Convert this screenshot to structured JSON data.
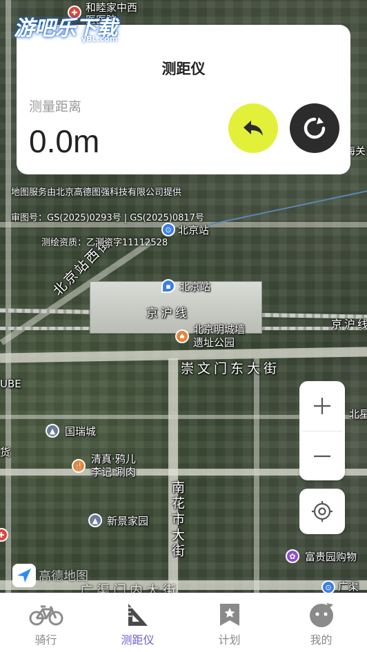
{
  "watermark": {
    "text": "游吧乐下载",
    "sub": "yBL.com"
  },
  "card": {
    "title": "测距仪",
    "distance_label": "测量距离",
    "distance_value": "0.0m",
    "undo_color": "#e3f03a",
    "reset_color": "#2c2c2c"
  },
  "map": {
    "provider_notice": "地图服务由北京高德图强科技有限公司提供",
    "approval_number": "审图号：GS(2025)0293号 | GS(2025)0817号",
    "survey_license": "测绘资质：乙测资字11112528",
    "labels": {
      "top_hospital": "和睦家中西\n医医院",
      "beijing_station_top": "北京站",
      "beijing_station": "北京站",
      "west_street": "北京站西街",
      "jinghu_line": "京沪线",
      "jinghu_line_right": "京沪线",
      "ming_wall": "北京明城墙\n遗址公园",
      "chongwenmen_street": "崇文门东大街",
      "guorui": "国瑞城",
      "qingzhen": "清真·鸦儿\n李记·涮肉",
      "xinjing": "新景家园",
      "nanhuashi": "南花市大街",
      "fuguiyuan": "富贵园购物",
      "guangqu": "广渠",
      "ube": "UBE",
      "huo": "货",
      "beixing": "北星",
      "haiguan": "海关",
      "guangqumen_bottom": "广渠门内大街"
    },
    "amap_logo": "高德地图",
    "zoom_in": "+",
    "zoom_out": "−"
  },
  "tabs": [
    {
      "label": "骑行",
      "icon": "bicycle-icon",
      "active": false
    },
    {
      "label": "测距仪",
      "icon": "set-square-icon",
      "active": true
    },
    {
      "label": "计划",
      "icon": "bookmark-star-icon",
      "active": false
    },
    {
      "label": "我的",
      "icon": "profile-face-icon",
      "active": false
    }
  ],
  "colors": {
    "accent": "#6a5cd6",
    "undo": "#e3f03a"
  }
}
